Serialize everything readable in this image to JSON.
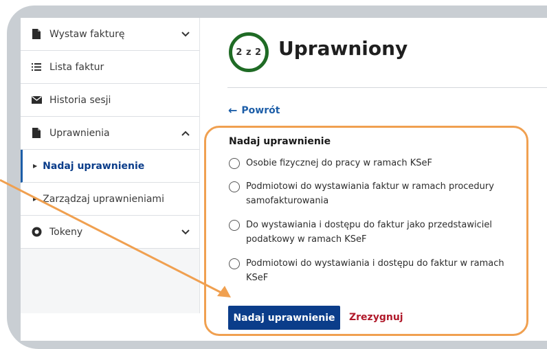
{
  "sidebar": {
    "items": [
      {
        "label": "Wystaw fakturę",
        "icon": "file-icon",
        "chevron": "down"
      },
      {
        "label": "Lista faktur",
        "icon": "list-icon"
      },
      {
        "label": "Historia sesji",
        "icon": "envelope-icon"
      },
      {
        "label": "Uprawnienia",
        "icon": "file-icon",
        "chevron": "up"
      },
      {
        "label": "Nadaj uprawnienie",
        "sub": true,
        "active": true
      },
      {
        "label": "Zarządzaj uprawnieniami",
        "sub": true
      },
      {
        "label": "Tokeny",
        "icon": "token-icon",
        "chevron": "down"
      }
    ]
  },
  "main": {
    "step": "2 z 2",
    "title": "Uprawniony",
    "back_label": "Powrót",
    "section_label": "Nadaj uprawnienie",
    "options": [
      {
        "label": "Osobie fizycznej do pracy w ramach KSeF"
      },
      {
        "label": "Podmiotowi do wystawiania faktur w ramach procedury samofakturowania"
      },
      {
        "label": "Do wystawiania i dostępu do faktur jako przedstawiciel podatkowy w ramach KSeF"
      },
      {
        "label": "Podmiotowi do wystawiania i dostępu do faktur w ramach KSeF"
      }
    ],
    "submit_label": "Nadaj uprawnienie",
    "cancel_label": "Zrezygnuj"
  },
  "colors": {
    "primary": "#0b3d8a",
    "link": "#1d5ea8",
    "cancel": "#b0192a",
    "step_ring": "#1f6b25",
    "highlight": "#f0a050"
  }
}
